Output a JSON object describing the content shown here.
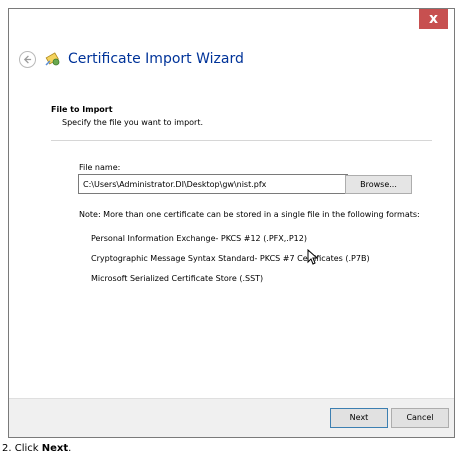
{
  "window": {
    "close_glyph": "x",
    "title": "Certificate Import Wizard",
    "accent_color": "#003399",
    "close_color": "#c75050"
  },
  "page": {
    "section_title": "File to Import",
    "section_desc": "Specify the file you want to import."
  },
  "file": {
    "label": "File name:",
    "value": "C:\\Users\\Administrator.DI\\Desktop\\gw\\nist.pfx",
    "browse_label": "Browse..."
  },
  "note": "Note:  More than one certificate can be stored in a single file in the following formats:",
  "formats": [
    "Personal Information Exchange- PKCS #12 (.PFX,.P12)",
    "Cryptographic Message Syntax Standard- PKCS #7 Certificates (.P7B)",
    "Microsoft Serialized Certificate Store (.SST)"
  ],
  "footer": {
    "next_label": "Next",
    "cancel_label": "Cancel"
  },
  "caption": {
    "prefix": "2. Click ",
    "bold": "Next",
    "suffix": "."
  },
  "icons": {
    "back": "back-arrow-icon",
    "wizard": "certificate-icon",
    "cursor": "mouse-pointer-icon"
  }
}
